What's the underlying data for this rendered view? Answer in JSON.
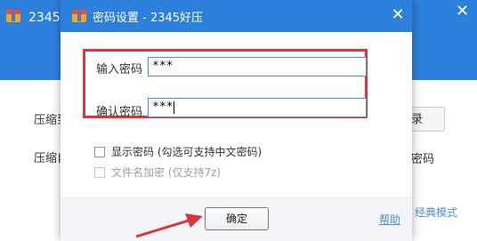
{
  "background_window": {
    "title": "2345好",
    "label_row1": "压缩到",
    "label_row2": "压缩自",
    "browse_btn": "录",
    "right_row2": "密码",
    "classic_link": "经典模式"
  },
  "dialog": {
    "title": "密码设置 - 2345好压",
    "password_label": "输入密码",
    "password_value": "***",
    "confirm_label": "确认密码",
    "confirm_value": "***",
    "show_password_label": "显示密码 (勾选可支持中文密码)",
    "encrypt_filenames_label": "文件名加密 (仅支持7z)",
    "ok_label": "确定",
    "help_label": "帮助"
  },
  "colors": {
    "titlebar": "#2d7fdc",
    "highlight": "#d9363e",
    "link": "#4a90d9"
  },
  "icons": [
    "app-logo-icon",
    "close-icon",
    "annotation-arrow-icon"
  ]
}
